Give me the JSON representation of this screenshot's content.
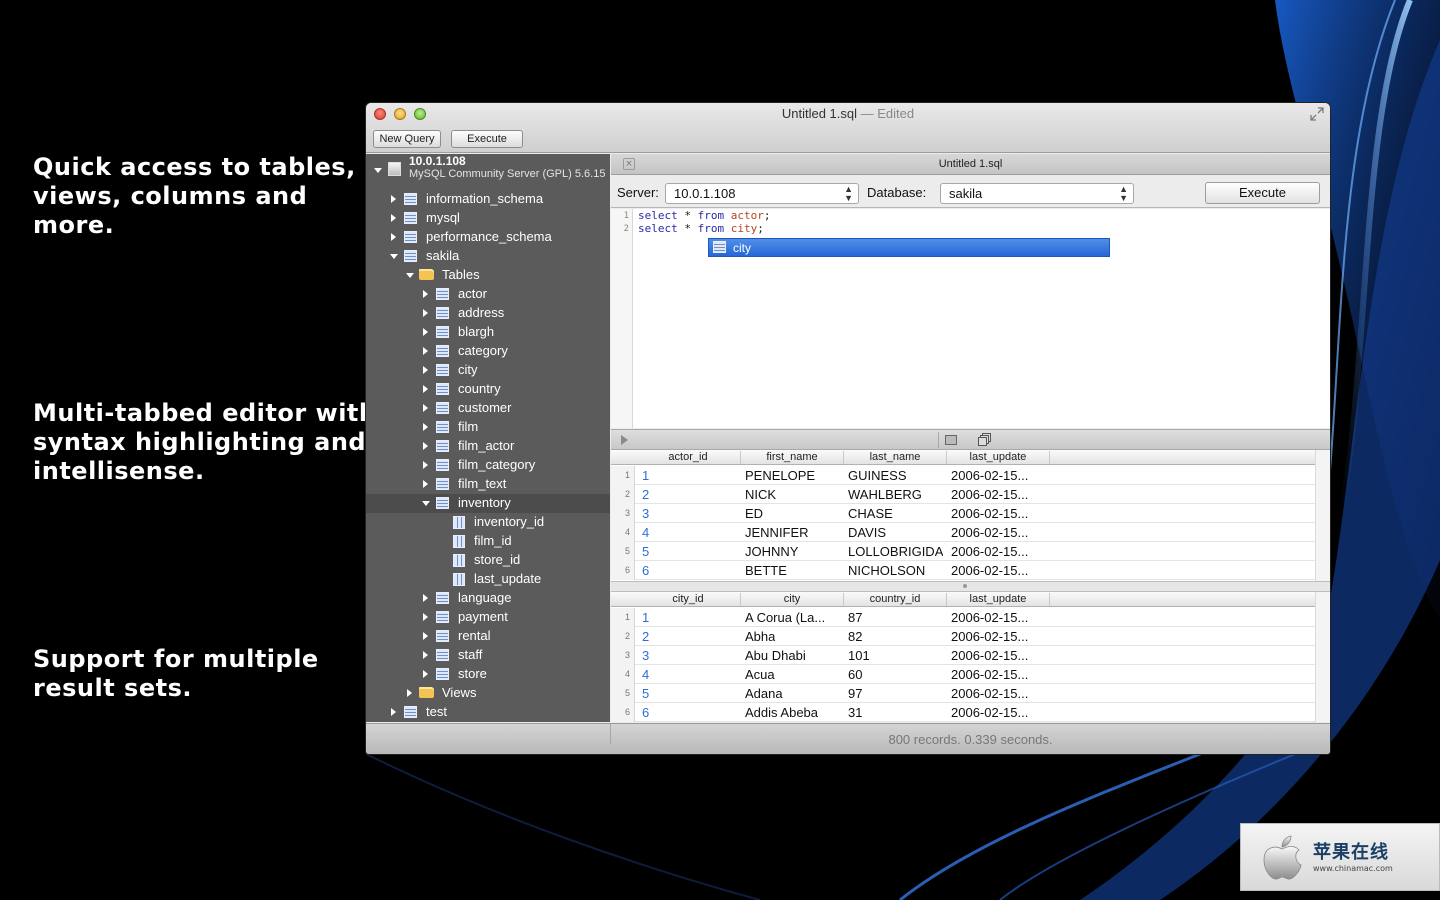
{
  "captions": [
    "Quick access to tables,\nviews, columns and\nmore.",
    "Multi-tabbed editor with\nsyntax highlighting and\nintellisense.",
    "Support for multiple\nresult sets."
  ],
  "window": {
    "title": "Untitled 1.sql",
    "title_sep": " — ",
    "title_status": "Edited"
  },
  "toolbar": {
    "new_query_label": "New Query",
    "execute_label": "Execute"
  },
  "sidebar": {
    "server_host": "10.0.1.108",
    "server_desc": "MySQL Community Server (GPL) 5.6.15",
    "schemas": [
      "information_schema",
      "mysql",
      "performance_schema",
      "sakila"
    ],
    "tables_folder": "Tables",
    "tables": [
      "actor",
      "address",
      "blargh",
      "category",
      "city",
      "country",
      "customer",
      "film",
      "film_actor",
      "film_category",
      "film_text",
      "inventory"
    ],
    "inventory_columns": [
      "inventory_id",
      "film_id",
      "store_id",
      "last_update"
    ],
    "tables_after": [
      "language",
      "payment",
      "rental",
      "staff",
      "store"
    ],
    "views_folder": "Views",
    "last_schema": "test"
  },
  "tab": {
    "title": "Untitled 1.sql"
  },
  "connection": {
    "server_label": "Server:",
    "server_value": "10.0.1.108",
    "database_label": "Database:",
    "database_value": "sakila",
    "execute_label": "Execute"
  },
  "editor": {
    "lines": [
      {
        "n": "1",
        "kw1": "select",
        "star": " * ",
        "kw2": "from",
        "obj": " actor",
        "end": ";"
      },
      {
        "n": "2",
        "kw1": "select",
        "star": " * ",
        "kw2": "from",
        "obj": " city",
        "end": ";"
      }
    ],
    "autocomplete": "city"
  },
  "results": [
    {
      "columns": [
        "actor_id",
        "first_name",
        "last_name",
        "last_update"
      ],
      "rows": [
        [
          "1",
          "1",
          "PENELOPE",
          "GUINESS",
          "2006-02-15..."
        ],
        [
          "2",
          "2",
          "NICK",
          "WAHLBERG",
          "2006-02-15..."
        ],
        [
          "3",
          "3",
          "ED",
          "CHASE",
          "2006-02-15..."
        ],
        [
          "4",
          "4",
          "JENNIFER",
          "DAVIS",
          "2006-02-15..."
        ],
        [
          "5",
          "5",
          "JOHNNY",
          "LOLLOBRIGIDA",
          "2006-02-15..."
        ],
        [
          "6",
          "6",
          "BETTE",
          "NICHOLSON",
          "2006-02-15..."
        ]
      ]
    },
    {
      "columns": [
        "city_id",
        "city",
        "country_id",
        "last_update"
      ],
      "rows": [
        [
          "1",
          "1",
          "A Corua (La...",
          "87",
          "2006-02-15..."
        ],
        [
          "2",
          "2",
          "Abha",
          "82",
          "2006-02-15..."
        ],
        [
          "3",
          "3",
          "Abu Dhabi",
          "101",
          "2006-02-15..."
        ],
        [
          "4",
          "4",
          "Acua",
          "60",
          "2006-02-15..."
        ],
        [
          "5",
          "5",
          "Adana",
          "97",
          "2006-02-15..."
        ],
        [
          "6",
          "6",
          "Addis Abeba",
          "31",
          "2006-02-15..."
        ]
      ]
    }
  ],
  "status": "800 records. 0.339 seconds.",
  "watermark": {
    "text": "苹果在线",
    "url": "www.chinamac.com"
  },
  "colors": {
    "sidebar_bg": "#5b5b5b",
    "autocomplete_bg": "#2667d8",
    "id_link": "#2a6fd6"
  }
}
